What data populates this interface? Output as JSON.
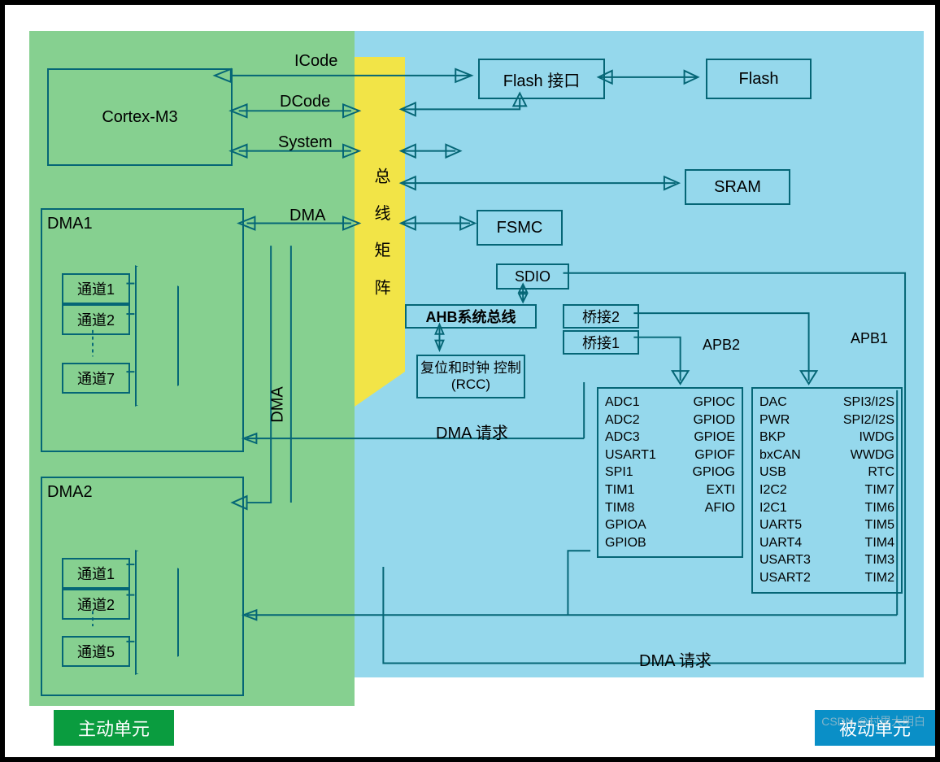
{
  "title_vertical": "总 线 矩 阵",
  "cortex": "Cortex-M3",
  "dma1": "DMA1",
  "dma2": "DMA2",
  "channels1": [
    "通道1",
    "通道2",
    "通道7"
  ],
  "channels2": [
    "通道1",
    "通道2",
    "通道5"
  ],
  "bus_labels": {
    "icode": "ICode",
    "dcode": "DCode",
    "system": "System",
    "dma": "DMA",
    "dma_v": "DMA"
  },
  "flash_if": "Flash 接口",
  "flash": "Flash",
  "sram": "SRAM",
  "fsmc": "FSMC",
  "sdio": "SDIO",
  "ahb": "AHB系统总线",
  "bridge1": "桥接1",
  "bridge2": "桥接2",
  "rcc": "复位和时钟 控制(RCC)",
  "apb1": "APB1",
  "apb2": "APB2",
  "dma_req1": "DMA 请求",
  "dma_req2": "DMA 请求",
  "active_unit": "主动单元",
  "passive_unit": "被动单元",
  "watermark": "CSDN @村里大明白",
  "apb2_peripherals": {
    "left": [
      "ADC1",
      "ADC2",
      "ADC3",
      "USART1",
      "SPI1",
      "TIM1",
      "TIM8",
      "GPIOA",
      "GPIOB"
    ],
    "right": [
      "GPIOC",
      "GPIOD",
      "GPIOE",
      "GPIOF",
      "GPIOG",
      "EXTI",
      "AFIO",
      ""
    ]
  },
  "apb1_peripherals": {
    "left": [
      "DAC",
      "PWR",
      "BKP",
      "bxCAN",
      "USB",
      "I2C2",
      "I2C1",
      "UART5",
      "UART4",
      "USART3",
      "USART2"
    ],
    "right": [
      "SPI3/I2S",
      "SPI2/I2S",
      "IWDG",
      "WWDG",
      "RTC",
      "TIM7",
      "TIM6",
      "TIM5",
      "TIM4",
      "TIM3",
      "TIM2"
    ]
  }
}
